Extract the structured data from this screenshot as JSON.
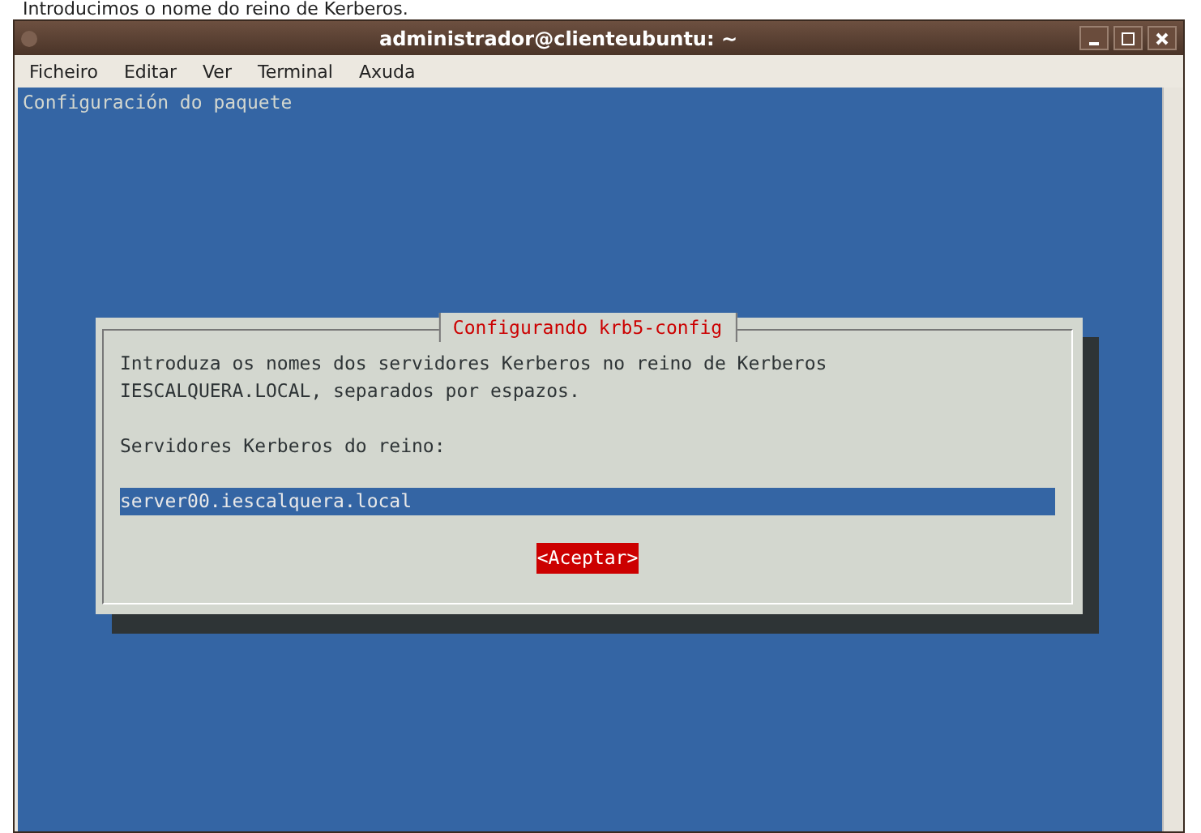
{
  "caption": "Introducimos o nome do reino de Kerberos.",
  "window": {
    "title": "administrador@clienteubuntu: ~"
  },
  "menu": [
    {
      "label": "Ficheiro"
    },
    {
      "label": "Editar"
    },
    {
      "label": "Ver"
    },
    {
      "label": "Terminal"
    },
    {
      "label": "Axuda"
    }
  ],
  "terminal": {
    "header": "Configuración do paquete",
    "dialog": {
      "title": "Configurando krb5-config",
      "message": "Introduza os nomes dos servidores Kerberos no reino de Kerberos IESCALQUERA.LOCAL, separados por espazos.",
      "prompt": "Servidores Kerberos do reino:",
      "input": {
        "value": "server00.iescalquera.local"
      },
      "buttons": [
        {
          "label": "<Aceptar>",
          "selected": true
        }
      ]
    }
  }
}
